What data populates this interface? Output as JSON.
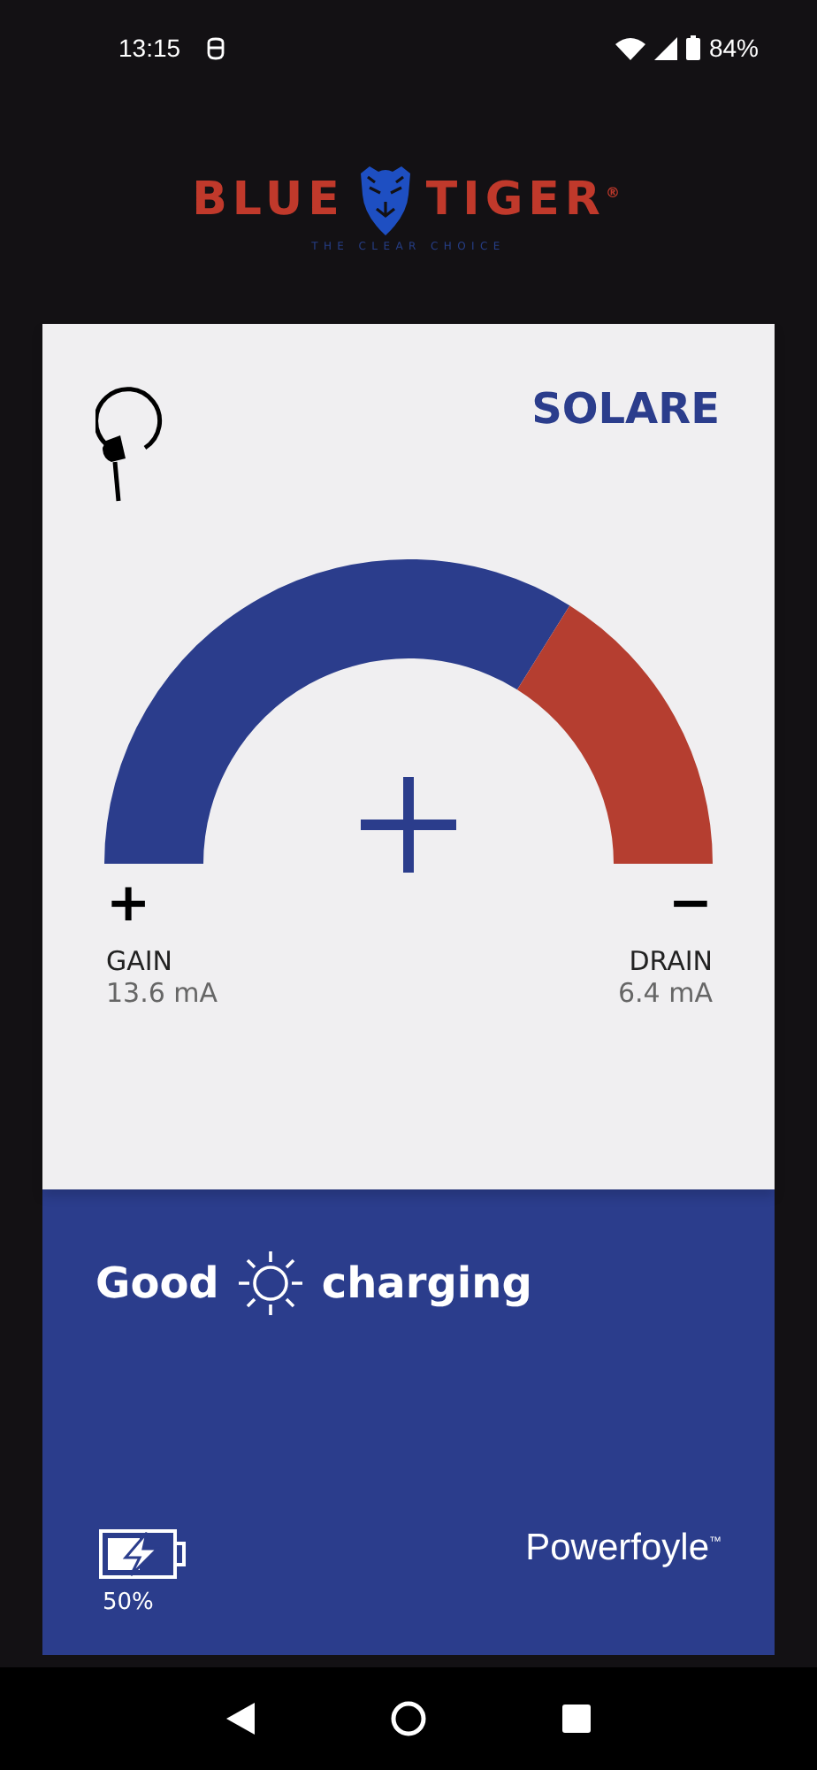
{
  "status_bar": {
    "time": "13:15",
    "battery": "84%"
  },
  "brand": {
    "left": "BLUE",
    "right": "TIGER$^{®}$",
    "tagline": "THE CLEAR CHOICE"
  },
  "card": {
    "title": "SOLARE",
    "gain": {
      "sign": "+",
      "label": "GAIN",
      "reading": "13.6 mA"
    },
    "drain": {
      "sign": "−",
      "label": "DRAIN",
      "reading": "6.4 mA"
    },
    "status": {
      "first": "Good",
      "second": "charging"
    },
    "battery": {
      "reading": "50%"
    },
    "maker": "Powerfoyle$^{™}$"
  }
}
